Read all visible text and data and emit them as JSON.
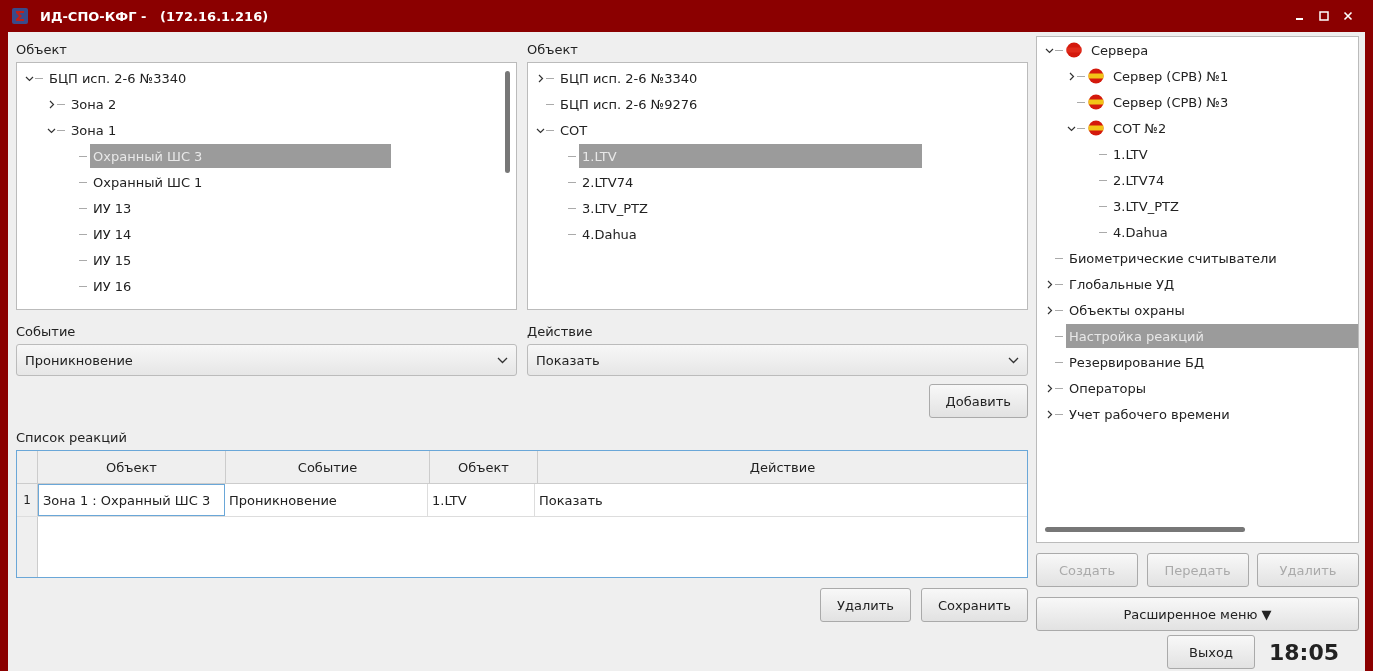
{
  "window": {
    "title": "ИД-СПО-КФГ -   (172.16.1.216)"
  },
  "object_panel_1": {
    "label": "Объект",
    "tree": [
      {
        "label": "БЦП исп. 2-6 №3340",
        "expanded": true,
        "selected": false,
        "children": [
          {
            "label": "Зона 2",
            "expanded": false,
            "selected": false
          },
          {
            "label": "Зона 1",
            "expanded": true,
            "selected": false,
            "children": [
              {
                "label": "Охранный ШС 3",
                "selected": true
              },
              {
                "label": "Охранный ШС 1",
                "selected": false
              },
              {
                "label": "ИУ 13",
                "selected": false
              },
              {
                "label": "ИУ 14",
                "selected": false
              },
              {
                "label": "ИУ 15",
                "selected": false
              },
              {
                "label": "ИУ 16",
                "selected": false
              }
            ]
          }
        ]
      }
    ]
  },
  "object_panel_2": {
    "label": "Объект",
    "tree": [
      {
        "label": "БЦП исп. 2-6 №3340",
        "expanded": false,
        "selected": false
      },
      {
        "label": "БЦП исп. 2-6 №9276",
        "selected": false
      },
      {
        "label": "СОТ",
        "expanded": true,
        "selected": false,
        "children": [
          {
            "label": "1.LTV",
            "selected": true
          },
          {
            "label": "2.LTV74",
            "selected": false
          },
          {
            "label": "3.LTV_PTZ",
            "selected": false
          },
          {
            "label": "4.Dahua",
            "selected": false
          }
        ]
      }
    ]
  },
  "event": {
    "label": "Событие",
    "value": "Проникновение"
  },
  "action": {
    "label": "Действие",
    "value": "Показать"
  },
  "add_button": "Добавить",
  "reactions": {
    "label": "Список реакций",
    "columns": [
      "Объект",
      "Событие",
      "Объект",
      "Действие"
    ],
    "rows": [
      {
        "number": "1",
        "cells": [
          "Зона 1 : Охранный ШС 3",
          "Проникновение",
          "1.LTV",
          "Показать"
        ]
      }
    ]
  },
  "bottom_buttons": [
    "Удалить",
    "Сохранить"
  ],
  "nav_tree": [
    {
      "label": "Сервера",
      "expanded": true,
      "selected": false,
      "color": "#e02a1a",
      "children": [
        {
          "label": "Сервер (СРВ) №1",
          "expanded": false,
          "selected": false,
          "color": "#f2c417"
        },
        {
          "label": "Сервер (СРВ) №3",
          "selected": false,
          "color": "#f2c417"
        },
        {
          "label": "СОТ №2",
          "expanded": true,
          "selected": false,
          "color": "#f2c417",
          "children": [
            {
              "label": "1.LTV",
              "selected": false
            },
            {
              "label": "2.LTV74",
              "selected": false
            },
            {
              "label": "3.LTV_PTZ",
              "selected": false
            },
            {
              "label": "4.Dahua",
              "selected": false
            }
          ]
        }
      ]
    },
    {
      "label": "Биометрические считыватели",
      "selected": false
    },
    {
      "label": "Глобальные УД",
      "expanded": false,
      "selected": false
    },
    {
      "label": "Объекты охраны",
      "expanded": false,
      "selected": false
    },
    {
      "label": "Настройка реакций",
      "selected": true
    },
    {
      "label": "Резервирование БД",
      "selected": false
    },
    {
      "label": "Операторы",
      "expanded": false,
      "selected": false
    },
    {
      "label": "Учет рабочего времени",
      "expanded": false,
      "selected": false
    }
  ],
  "nav_buttons": [
    {
      "label": "Создать",
      "disabled": true
    },
    {
      "label": "Передать",
      "disabled": true
    },
    {
      "label": "Удалить",
      "disabled": true
    }
  ],
  "extended_menu": "Расширенное меню ▼",
  "exit_button": "Выход",
  "clock": "18:05"
}
